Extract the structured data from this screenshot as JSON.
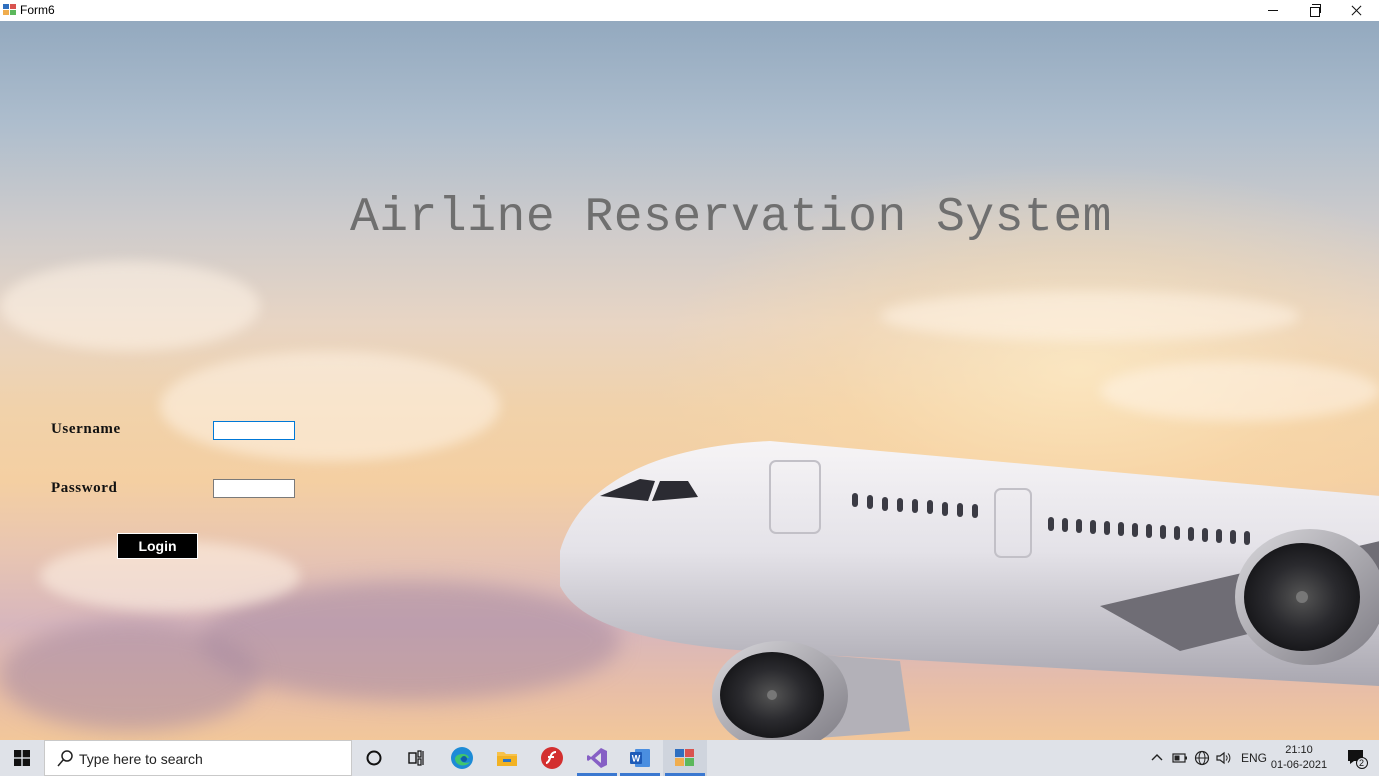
{
  "window": {
    "title": "Form6"
  },
  "form": {
    "heading": "Airline Reservation System",
    "username_label": "Username",
    "username_value": "",
    "password_label": "Password",
    "password_value": "",
    "login_label": "Login"
  },
  "taskbar": {
    "search_placeholder": "Type here to search",
    "apps": [
      "cortana-icon",
      "task-view-icon",
      "edge-icon",
      "file-explorer-icon",
      "flash-icon",
      "visual-studio-icon",
      "word-icon",
      "winforms-app-icon"
    ],
    "tray": {
      "language": "ENG",
      "time": "21:10",
      "date": "01-06-2021",
      "notification_count": "2"
    }
  },
  "colors": {
    "title_text": "#6f6f6f",
    "login_button_bg": "#000000",
    "focus_border": "#0078d7",
    "taskbar_bg": "#dfe2e8"
  }
}
